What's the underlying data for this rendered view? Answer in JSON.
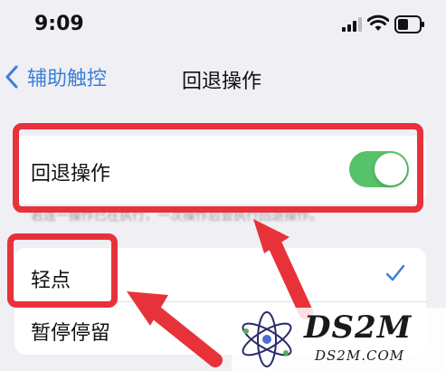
{
  "status_bar": {
    "time": "9:09"
  },
  "nav": {
    "back_label": "辅助触控",
    "title": "回退操作"
  },
  "settings": {
    "toggle_row_label": "回退操作",
    "toggle_on": true,
    "footnote": "若连一操作已在执行，一次操作后会执行回退操作。",
    "options": [
      {
        "label": "轻点",
        "selected": true
      },
      {
        "label": "暂停停留",
        "selected": false
      }
    ]
  },
  "watermark": {
    "title": "DS2M",
    "subtitle": "DS2M.COM"
  },
  "colors": {
    "accent": "#3b7fd9",
    "toggle_on": "#56c26a",
    "highlight": "#e8323a",
    "background": "#f0eff4"
  },
  "icons": {
    "back": "chevron-left-icon",
    "signal": "signal-icon",
    "wifi": "wifi-icon",
    "battery": "battery-icon",
    "check": "checkmark-icon"
  }
}
